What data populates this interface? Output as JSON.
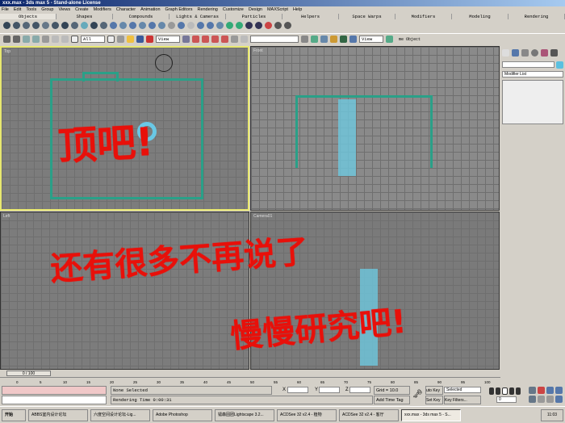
{
  "window": {
    "title": "xxx.max - 3ds max 5 - Stand-alone License"
  },
  "menu": [
    "File",
    "Edit",
    "Tools",
    "Group",
    "Views",
    "Create",
    "Modifiers",
    "Character",
    "Animation",
    "Graph Editors",
    "Rendering",
    "Customize",
    "Design",
    "MAXScript",
    "Help"
  ],
  "tabs": [
    "Objects",
    "Shapes",
    "Compounds",
    "Lights & Cameras",
    "Particles",
    "Helpers",
    "Space Warps",
    "Modifiers",
    "Modeling",
    "Rendering"
  ],
  "toolbar": {
    "selection_filter": "All",
    "ref_coord": "View",
    "view2": "View",
    "named_object": "me Object"
  },
  "viewports": [
    "Top",
    "Front",
    "Left",
    "Camera01"
  ],
  "annotations": [
    "顶吧!",
    "还有很多不再说了",
    "慢慢研究吧!"
  ],
  "command_panel": {
    "modifier_list": "Modifier List"
  },
  "timeline": {
    "frame": "0 / 100",
    "ticks": [
      "0",
      "5",
      "10",
      "15",
      "20",
      "25",
      "30",
      "35",
      "40",
      "45",
      "50",
      "55",
      "60",
      "65",
      "70",
      "75",
      "80",
      "85",
      "90",
      "95",
      "100"
    ]
  },
  "status": {
    "selection": "None Selected",
    "render_time": "Rendering Time  0:00:31",
    "x": "X",
    "y": "Y",
    "z": "Z",
    "grid": "Grid = 10.0",
    "add_time_tag": "Add Time Tag",
    "auto_key": "uto Key",
    "set_key": "Set Key",
    "key_mode": "Selected",
    "key_filters": "Key Filters...",
    "frame_field": "0"
  },
  "taskbar": {
    "start": "开始",
    "items": [
      "ABBS室内设计论坛",
      "六度空间设计论坛-Lig...",
      "Adobe Photoshop",
      "镭森固团Lightscape 3.2...",
      "ACDSee 32 v2.4 - 植物",
      "ACDSee 32 v2.4 - 客厅",
      "xxx.max - 3ds max 5 - S..."
    ],
    "clock": "11:03"
  }
}
